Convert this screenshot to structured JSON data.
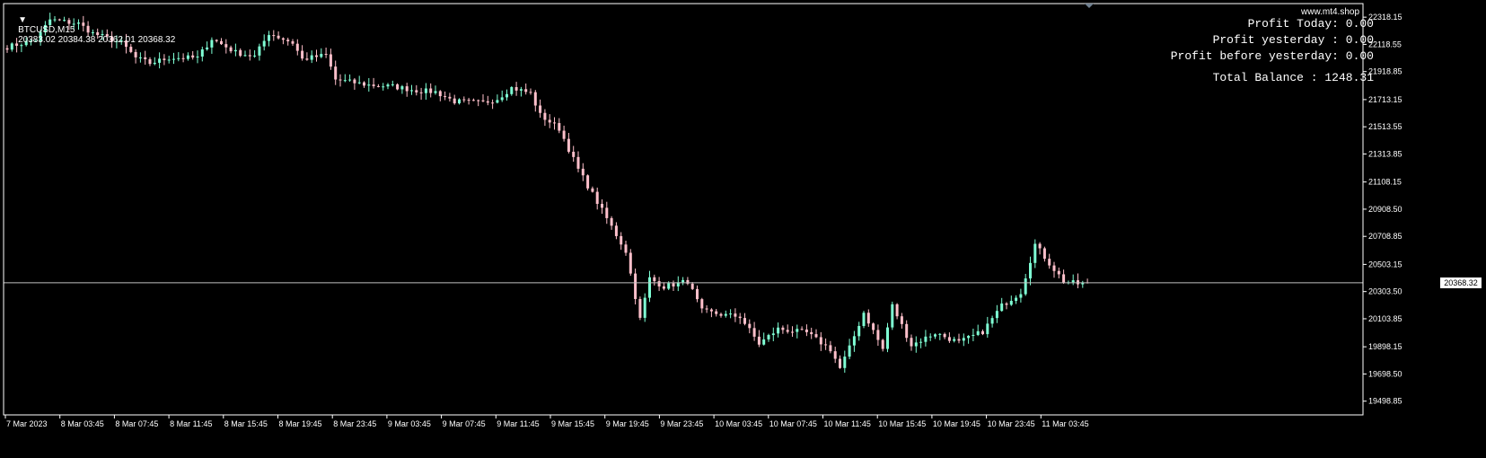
{
  "header": {
    "symbol": "BTCUSD,M15",
    "ohlc": "20383.02 20384.38 20362.01 20368.32"
  },
  "watermark": "www.mt4.shop",
  "profit_panel": {
    "today": "Profit Today: 0.00",
    "yesterday": "Profit yesterday : 0.00",
    "before_yesterday": "Profit before yesterday: 0.00",
    "total_balance": "Total Balance : 1248.31"
  },
  "current_price_label": "20368.32",
  "colors": {
    "background": "#000000",
    "bull": "#7fffd4",
    "bear": "#ffc0cb",
    "axis": "#ffffff",
    "price_line": "#c0c0c0"
  },
  "chart_data": {
    "type": "candlestick",
    "symbol": "BTCUSD",
    "timeframe": "M15",
    "ylim": [
      19398,
      22418
    ],
    "y_ticks": [
      "22318.15",
      "22118.55",
      "21918.85",
      "21713.15",
      "21513.55",
      "21313.85",
      "21108.15",
      "20908.50",
      "20708.85",
      "20503.15",
      "20303.50",
      "20103.85",
      "19898.15",
      "19698.50",
      "19498.85"
    ],
    "x_ticks": [
      "7 Mar 2023",
      "8 Mar 03:45",
      "8 Mar 07:45",
      "8 Mar 11:45",
      "8 Mar 15:45",
      "8 Mar 19:45",
      "8 Mar 23:45",
      "9 Mar 03:45",
      "9 Mar 07:45",
      "9 Mar 11:45",
      "9 Mar 15:45",
      "9 Mar 19:45",
      "9 Mar 23:45",
      "10 Mar 03:45",
      "10 Mar 07:45",
      "10 Mar 11:45",
      "10 Mar 15:45",
      "10 Mar 19:45",
      "10 Mar 23:45",
      "11 Mar 03:45"
    ],
    "current_price": 20368.32,
    "path_points": [
      [
        0,
        22100
      ],
      [
        6,
        22150
      ],
      [
        9,
        22300
      ],
      [
        15,
        22270
      ],
      [
        18,
        22200
      ],
      [
        24,
        22130
      ],
      [
        27,
        22020
      ],
      [
        30,
        21980
      ],
      [
        34,
        22020
      ],
      [
        40,
        22020
      ],
      [
        43,
        22160
      ],
      [
        48,
        22060
      ],
      [
        52,
        22030
      ],
      [
        55,
        22200
      ],
      [
        60,
        22130
      ],
      [
        62,
        22010
      ],
      [
        67,
        22040
      ],
      [
        69,
        21860
      ],
      [
        76,
        21820
      ],
      [
        81,
        21810
      ],
      [
        86,
        21780
      ],
      [
        90,
        21770
      ],
      [
        94,
        21700
      ],
      [
        100,
        21690
      ],
      [
        103,
        21720
      ],
      [
        106,
        21800
      ],
      [
        110,
        21760
      ],
      [
        112,
        21600
      ],
      [
        116,
        21500
      ],
      [
        120,
        21200
      ],
      [
        125,
        20900
      ],
      [
        130,
        20600
      ],
      [
        133,
        20100
      ],
      [
        135,
        20400
      ],
      [
        138,
        20340
      ],
      [
        143,
        20380
      ],
      [
        146,
        20160
      ],
      [
        151,
        20130
      ],
      [
        154,
        20120
      ],
      [
        158,
        19920
      ],
      [
        162,
        20030
      ],
      [
        168,
        20000
      ],
      [
        173,
        19880
      ],
      [
        175,
        19740
      ],
      [
        177,
        19890
      ],
      [
        180,
        20150
      ],
      [
        184,
        19880
      ],
      [
        186,
        20200
      ],
      [
        190,
        19910
      ],
      [
        195,
        20000
      ],
      [
        200,
        19930
      ],
      [
        205,
        20010
      ],
      [
        209,
        20200
      ],
      [
        213,
        20300
      ],
      [
        216,
        20650
      ],
      [
        219,
        20510
      ],
      [
        222,
        20380
      ],
      [
        225,
        20360
      ],
      [
        227,
        20368
      ]
    ]
  }
}
